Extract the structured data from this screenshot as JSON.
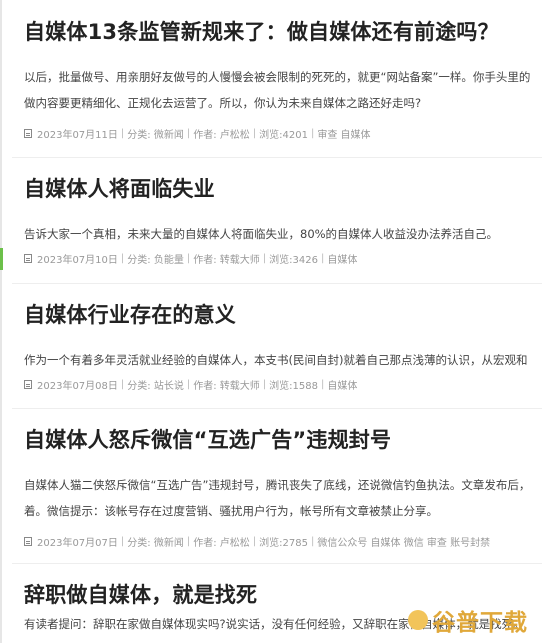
{
  "articles": [
    {
      "title": "自媒体13条监管新规来了：做自媒体还有前途吗？",
      "excerpt_lines": [
        "以后，批量做号、用亲朋好友做号的人慢慢会被会限制的死死的，就更“网站备案”一样。你手头里的",
        "做内容要更精细化、正规化去运营了。所以，你认为未来自媒体之路还好走吗?"
      ],
      "date": "2023年07月11日",
      "category_label": "分类: 微新闻",
      "author_label": "作者: 卢松松",
      "views_label": "浏览:4201",
      "tags": [
        "审查",
        "自媒体"
      ]
    },
    {
      "title": "自媒体人将面临失业",
      "excerpt_lines": [
        "告诉大家一个真相，未来大量的自媒体人将面临失业，80%的自媒体人收益没办法养活自己。"
      ],
      "date": "2023年07月10日",
      "category_label": "分类: 负能量",
      "author_label": "作者: 转载大师",
      "views_label": "浏览:3426",
      "tags": [
        "自媒体"
      ]
    },
    {
      "title": "自媒体行业存在的意义",
      "excerpt_lines": [
        "作为一个有着多年灵活就业经验的自媒体人，本支书(民间自封)就着自己那点浅薄的认识，从宏观和"
      ],
      "date": "2023年07月08日",
      "category_label": "分类: 站长说",
      "author_label": "作者: 转载大师",
      "views_label": "浏览:1588",
      "tags": [
        "自媒体"
      ]
    },
    {
      "title": "自媒体人怒斥微信“互选广告”违规封号",
      "excerpt_lines": [
        "自媒体人猫二侠怒斥微信“互选广告”违规封号，腾讯丧失了底线，还说微信钓鱼执法。文章发布后，",
        "着。微信提示：该帐号存在过度营销、骚扰用户行为，帐号所有文章被禁止分享。"
      ],
      "date": "2023年07月07日",
      "category_label": "分类: 微新闻",
      "author_label": "作者: 卢松松",
      "views_label": "浏览:2785",
      "tags": [
        "微信公众号",
        "自媒体",
        "微信",
        "审查",
        "账号封禁"
      ]
    },
    {
      "title": "辞职做自媒体，就是找死",
      "excerpt_lines": [
        "有读者提问：辞职在家做自媒体现实吗?说实话，没有任何经验，又辞职在家做自媒体，就是找死。"
      ],
      "date": "",
      "category_label": "",
      "author_label": "",
      "views_label": "",
      "tags": []
    }
  ],
  "watermark": {
    "text": "谷普下载"
  },
  "colors": {
    "title": "#222222",
    "excerpt": "#444444",
    "meta": "#999999",
    "accent": "#6cc04a",
    "watermark": "#e0a83a"
  }
}
